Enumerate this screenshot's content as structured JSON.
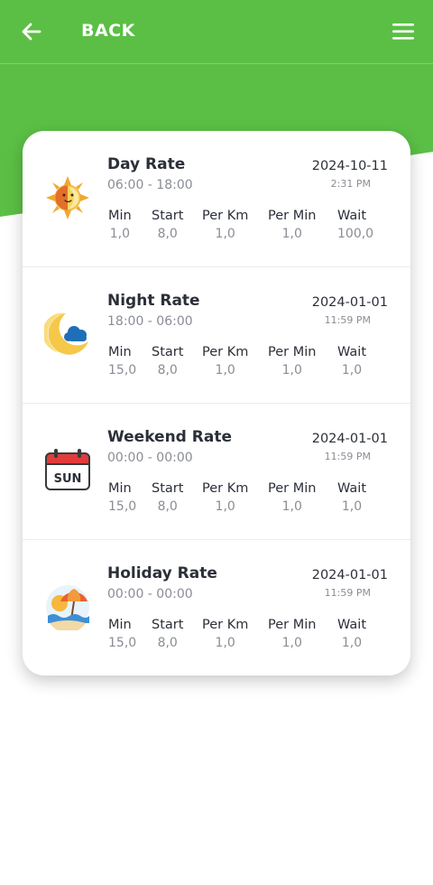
{
  "colors": {
    "brand_green": "#5bbf45",
    "text_dark": "#2b2f38",
    "text_muted": "#8a8d94"
  },
  "header": {
    "back_label": "BACK",
    "back_icon": "arrow-left-icon",
    "menu_icon": "hamburger-menu-icon"
  },
  "metric_labels": {
    "min": "Min",
    "start": "Start",
    "per_km": "Per Km",
    "per_min": "Per Min",
    "wait": "Wait"
  },
  "rates": [
    {
      "title": "Day Rate",
      "time_range": "06:00 - 18:00",
      "date": "2024-10-11",
      "time": "2:31 PM",
      "icon": "sun-icon",
      "values": {
        "min": "1,0",
        "start": "8,0",
        "per_km": "1,0",
        "per_min": "1,0",
        "wait": "100,0"
      }
    },
    {
      "title": "Night Rate",
      "time_range": "18:00 - 06:00",
      "date": "2024-01-01",
      "time": "11:59 PM",
      "icon": "moon-cloud-icon",
      "values": {
        "min": "15,0",
        "start": "8,0",
        "per_km": "1,0",
        "per_min": "1,0",
        "wait": "1,0"
      }
    },
    {
      "title": "Weekend Rate",
      "time_range": "00:00 - 00:00",
      "date": "2024-01-01",
      "time": "11:59 PM",
      "icon": "calendar-sun-icon",
      "calendar_text": "SUN",
      "values": {
        "min": "15,0",
        "start": "8,0",
        "per_km": "1,0",
        "per_min": "1,0",
        "wait": "1,0"
      }
    },
    {
      "title": "Holiday Rate",
      "time_range": "00:00 - 00:00",
      "date": "2024-01-01",
      "time": "11:59 PM",
      "icon": "beach-umbrella-icon",
      "values": {
        "min": "15,0",
        "start": "8,0",
        "per_km": "1,0",
        "per_min": "1,0",
        "wait": "1,0"
      }
    }
  ]
}
